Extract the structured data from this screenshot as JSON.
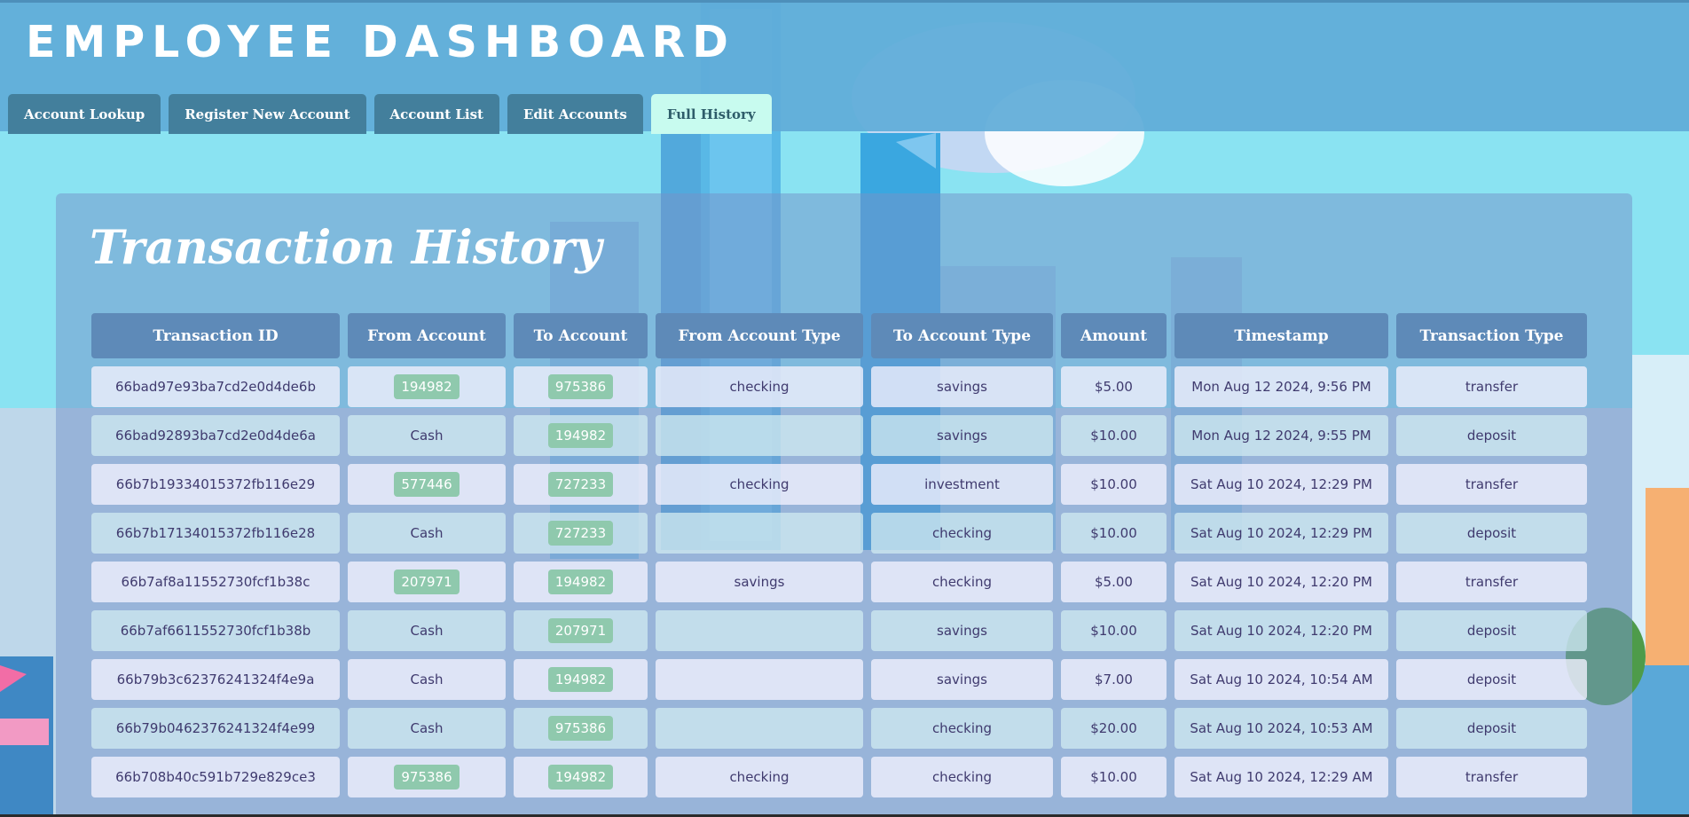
{
  "header": {
    "app_title": "EMPLOYEE  DASHBOARD"
  },
  "tabs": [
    {
      "label": "Account Lookup",
      "active": false
    },
    {
      "label": "Register New Account",
      "active": false
    },
    {
      "label": "Account List",
      "active": false
    },
    {
      "label": "Edit Accounts",
      "active": false
    },
    {
      "label": "Full History",
      "active": true
    }
  ],
  "page": {
    "title": "Transaction History"
  },
  "table": {
    "headers": [
      "Transaction ID",
      "From Account",
      "To Account",
      "From Account Type",
      "To Account Type",
      "Amount",
      "Timestamp",
      "Transaction Type"
    ],
    "rows": [
      {
        "id": "66bad97e93ba7cd2e0d4de6b",
        "from": "194982",
        "to": "975386",
        "from_type": "checking",
        "to_type": "savings",
        "amount": "$5.00",
        "timestamp": "Mon Aug 12 2024, 9:56 PM",
        "type": "transfer"
      },
      {
        "id": "66bad92893ba7cd2e0d4de6a",
        "from": "Cash",
        "to": "194982",
        "from_type": "",
        "to_type": "savings",
        "amount": "$10.00",
        "timestamp": "Mon Aug 12 2024, 9:55 PM",
        "type": "deposit"
      },
      {
        "id": "66b7b19334015372fb116e29",
        "from": "577446",
        "to": "727233",
        "from_type": "checking",
        "to_type": "investment",
        "amount": "$10.00",
        "timestamp": "Sat Aug 10 2024, 12:29 PM",
        "type": "transfer"
      },
      {
        "id": "66b7b17134015372fb116e28",
        "from": "Cash",
        "to": "727233",
        "from_type": "",
        "to_type": "checking",
        "amount": "$10.00",
        "timestamp": "Sat Aug 10 2024, 12:29 PM",
        "type": "deposit"
      },
      {
        "id": "66b7af8a11552730fcf1b38c",
        "from": "207971",
        "to": "194982",
        "from_type": "savings",
        "to_type": "checking",
        "amount": "$5.00",
        "timestamp": "Sat Aug 10 2024, 12:20 PM",
        "type": "transfer"
      },
      {
        "id": "66b7af6611552730fcf1b38b",
        "from": "Cash",
        "to": "207971",
        "from_type": "",
        "to_type": "savings",
        "amount": "$10.00",
        "timestamp": "Sat Aug 10 2024, 12:20 PM",
        "type": "deposit"
      },
      {
        "id": "66b79b3c62376241324f4e9a",
        "from": "Cash",
        "to": "194982",
        "from_type": "",
        "to_type": "savings",
        "amount": "$7.00",
        "timestamp": "Sat Aug 10 2024, 10:54 AM",
        "type": "deposit"
      },
      {
        "id": "66b79b0462376241324f4e99",
        "from": "Cash",
        "to": "975386",
        "from_type": "",
        "to_type": "checking",
        "amount": "$20.00",
        "timestamp": "Sat Aug 10 2024, 10:53 AM",
        "type": "deposit"
      },
      {
        "id": "66b708b40c591b729e829ce3",
        "from": "975386",
        "to": "194982",
        "from_type": "checking",
        "to_type": "checking",
        "amount": "$10.00",
        "timestamp": "Sat Aug 10 2024, 12:29 AM",
        "type": "transfer"
      }
    ]
  },
  "colors": {
    "header_bg": "#60acd8",
    "tab_bg": "#437f9c",
    "tab_active_bg": "#c8fbef",
    "table_header_bg": "#5e8ab8",
    "account_badge_bg": "#8fc9ad",
    "cell_text": "#3f3a6e"
  }
}
